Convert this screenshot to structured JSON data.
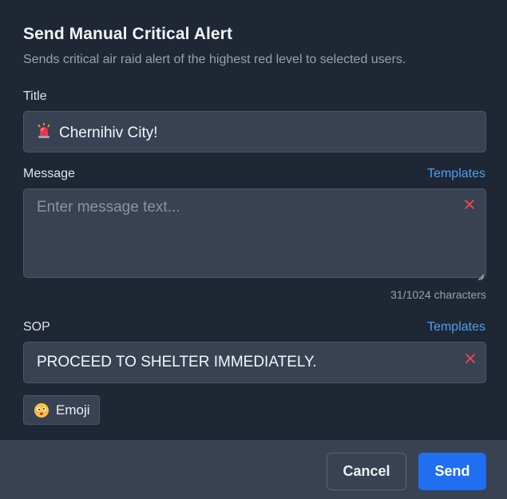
{
  "dialog": {
    "title": "Send Manual Critical Alert",
    "subtitle": "Sends critical air raid alert of the highest red level to selected users."
  },
  "title_field": {
    "label": "Title",
    "value": "Chernihiv City!",
    "icon": "siren-icon"
  },
  "message_field": {
    "label": "Message",
    "templates_link": "Templates",
    "value": "",
    "placeholder": "Enter message text...",
    "counter": "31/1024 characters"
  },
  "sop_field": {
    "label": "SOP",
    "templates_link": "Templates",
    "value": "PROCEED TO SHELTER IMMEDIATELY."
  },
  "emoji_button": {
    "label": "Emoji",
    "icon": "smiley-face-icon"
  },
  "footer": {
    "cancel_label": "Cancel",
    "send_label": "Send"
  },
  "colors": {
    "background": "#1f2735",
    "field": "#384253",
    "accent": "#1f6ff0",
    "link": "#4aa0f0",
    "clear": "#e5484d"
  }
}
